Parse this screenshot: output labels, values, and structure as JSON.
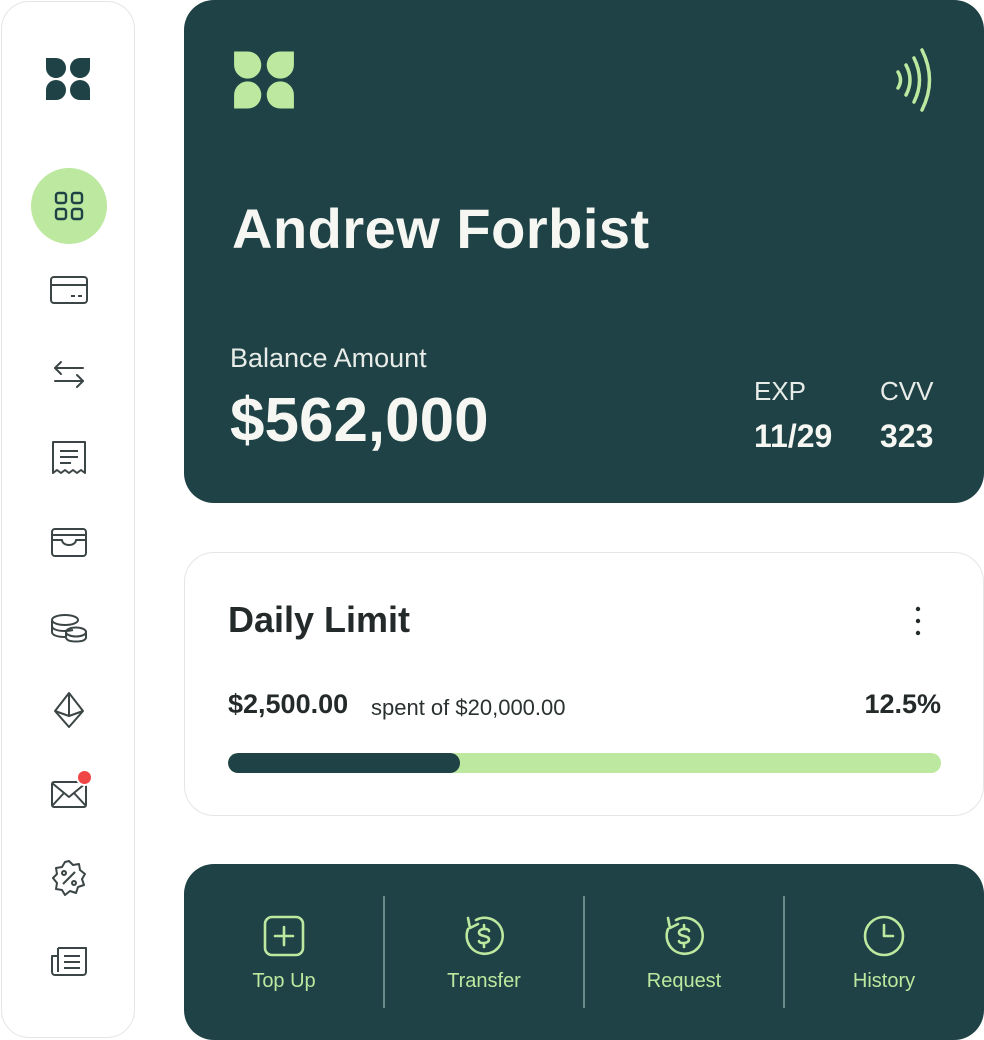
{
  "sidebar": {
    "items": [
      {
        "name": "dashboard",
        "icon": "grid-icon",
        "active": true
      },
      {
        "name": "cards",
        "icon": "credit-card-icon",
        "active": false
      },
      {
        "name": "transfers",
        "icon": "arrows-exchange-icon",
        "active": false
      },
      {
        "name": "receipts",
        "icon": "receipt-icon",
        "active": false
      },
      {
        "name": "wallet",
        "icon": "wallet-icon",
        "active": false
      },
      {
        "name": "coins",
        "icon": "coins-icon",
        "active": false
      },
      {
        "name": "crypto",
        "icon": "ethereum-icon",
        "active": false
      },
      {
        "name": "messages",
        "icon": "mail-icon",
        "active": false,
        "notification": true
      },
      {
        "name": "discounts",
        "icon": "discount-badge-icon",
        "active": false
      },
      {
        "name": "news",
        "icon": "newspaper-icon",
        "active": false
      }
    ]
  },
  "card": {
    "holder_name": "Andrew Forbist",
    "balance_label": "Balance Amount",
    "balance_value": "$562,000",
    "exp_label": "EXP",
    "exp_value": "11/29",
    "cvv_label": "CVV",
    "cvv_value": "323",
    "logo_icon": "brand-logo-icon",
    "contactless_icon": "contactless-icon"
  },
  "daily_limit": {
    "title": "Daily Limit",
    "spent_amount": "$2,500.00",
    "spent_of_text": "spent of $20,000.00",
    "percent_text": "12.5%",
    "progress": 0.325
  },
  "actions": [
    {
      "label": "Top Up",
      "icon": "plus-square-icon"
    },
    {
      "label": "Transfer",
      "icon": "dollar-refresh-icon"
    },
    {
      "label": "Request",
      "icon": "dollar-refresh-icon"
    },
    {
      "label": "History",
      "icon": "clock-icon"
    }
  ],
  "colors": {
    "primary_dark": "#1e4245",
    "accent_green": "#bde89f",
    "notification_red": "#f04545"
  }
}
